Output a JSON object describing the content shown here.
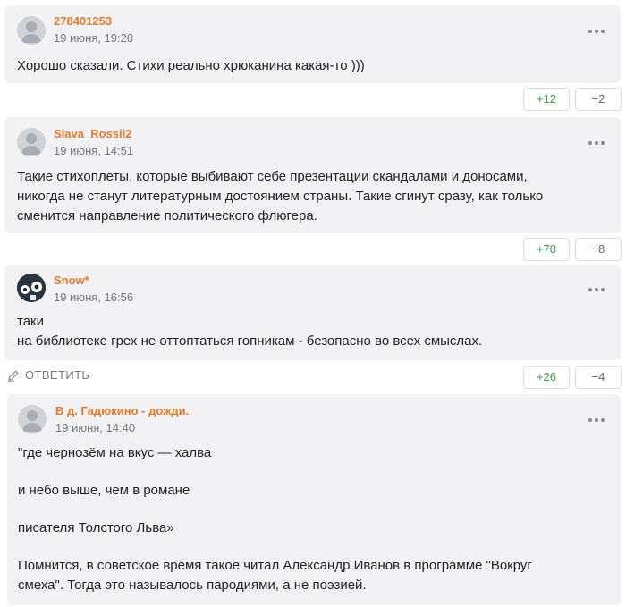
{
  "comments": [
    {
      "username": "278401253",
      "time": "19 июня, 19:20",
      "lines": [
        "Хорошо сказали. Стихи реально хрюканина какая-то )))"
      ],
      "upvotes": "+12",
      "downvotes": "−2"
    },
    {
      "username": "Slava_Rossii2",
      "time": "19 июня, 14:51",
      "lines": [
        "Такие стихоплеты, которые выбивают себе презентации скандалами и доносами,",
        "никогда не станут литературным достоянием страны. Такие сгинут сразу, как только",
        "сменится направление политического флюгера."
      ],
      "upvotes": "+70",
      "downvotes": "−8"
    },
    {
      "username": "Snow*",
      "time": "19 июня, 16:56",
      "lines": [
        "таки",
        "на библиотеке грех не оттоптаться гопникам - безопасно во всех смыслах."
      ],
      "upvotes": "+26",
      "downvotes": "−4",
      "reply_label": "ОТВЕТИТЬ"
    },
    {
      "username": "В д. Гадюкино - дожди.",
      "time": "19 июня, 14:40",
      "lines": [
        "\"где чернозём на вкус — халва",
        "и небо выше, чем в романе",
        "писателя Толстого Льва»",
        "Помнится, в советское время такое читал Александр Иванов в программе \"Вокруг",
        "смеха\". Тогда это называлось пародиями, а не поэзией."
      ]
    }
  ],
  "icons": {
    "avatar": "avatar-placeholder-icon",
    "menu": "more-dots-icon",
    "reply": "pencil-icon"
  },
  "colors": {
    "username": "#e07a2e",
    "plus": "#3a9a46",
    "card": "#f2f2f4"
  }
}
